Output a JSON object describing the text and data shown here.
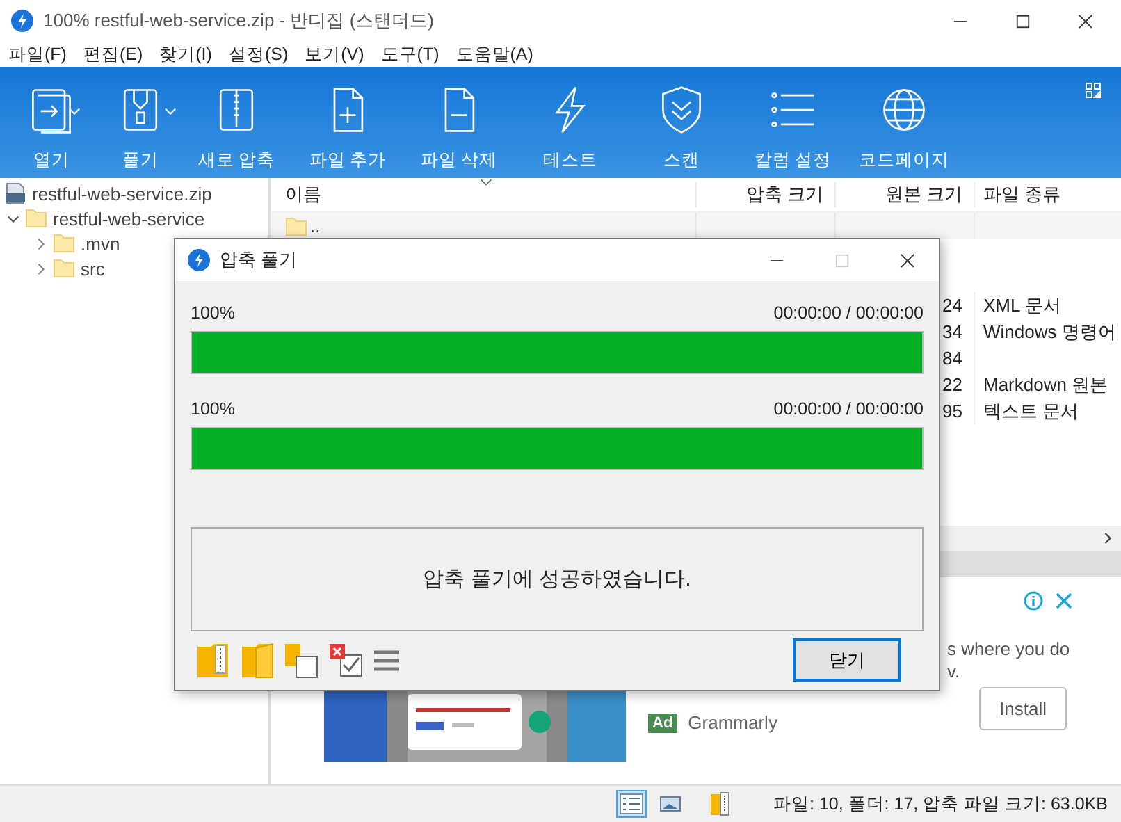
{
  "window": {
    "title": "100% restful-web-service.zip - 반디집 (스탠더드)"
  },
  "menu": [
    "파일(F)",
    "편집(E)",
    "찾기(I)",
    "설정(S)",
    "보기(V)",
    "도구(T)",
    "도움말(A)"
  ],
  "toolbar": [
    {
      "label": "열기",
      "kind": "open",
      "has_menu": true
    },
    {
      "label": "풀기",
      "kind": "extract",
      "has_menu": true
    },
    {
      "label": "새로 압축",
      "kind": "zip",
      "has_menu": false
    },
    {
      "label": "파일 추가",
      "kind": "add",
      "has_menu": false
    },
    {
      "label": "파일 삭제",
      "kind": "delete",
      "has_menu": false
    },
    {
      "label": "테스트",
      "kind": "test",
      "has_menu": false
    },
    {
      "label": "스캔",
      "kind": "scan",
      "has_menu": false
    },
    {
      "label": "칼럼 설정",
      "kind": "columns",
      "has_menu": false
    },
    {
      "label": "코드페이지",
      "kind": "codepage",
      "has_menu": false
    }
  ],
  "tree": {
    "root": "restful-web-service.zip",
    "items": [
      {
        "label": "restful-web-service",
        "expanded": true,
        "children": [
          {
            "label": ".mvn",
            "expanded": false
          },
          {
            "label": "src",
            "expanded": false
          }
        ]
      }
    ]
  },
  "list": {
    "columns": [
      "이름",
      "압축 크기",
      "원본 크기",
      "파일 종류"
    ],
    "rows": [
      {
        "name": ".."
      },
      {
        "original_size": "24",
        "type": "XML 문서"
      },
      {
        "original_size": "34",
        "type": "Windows 명령어"
      },
      {
        "original_size": "84"
      },
      {
        "original_size": "22",
        "type": "Markdown 원본"
      },
      {
        "original_size": "95",
        "type": "텍스트 문서"
      }
    ]
  },
  "ad": {
    "lines": [
      "s where you do",
      "v."
    ],
    "badge": "Ad",
    "advertiser": "Grammarly",
    "button": "Install"
  },
  "dialog": {
    "title": "압축 풀기",
    "progress": [
      {
        "label": "100%",
        "time": "00:00:00 / 00:00:00",
        "level": 1
      },
      {
        "label": "100%",
        "time": "00:00:00 / 00:00:00",
        "level": 1
      }
    ],
    "message": "압축 풀기에 성공하였습니다.",
    "button": "닫기"
  },
  "status_bar": {
    "views": [
      {
        "kind": "details",
        "selected": true
      },
      {
        "kind": "thumbnails",
        "selected": false
      }
    ],
    "text": "파일: 10, 폴더: 17, 압축 파일 크기: 63.0KB"
  }
}
